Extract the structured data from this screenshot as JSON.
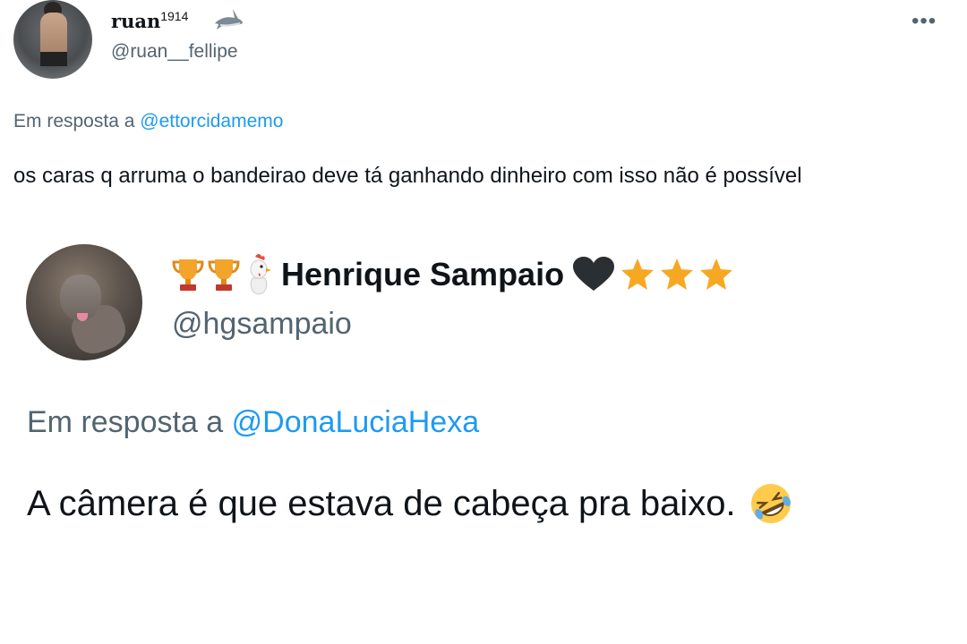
{
  "tweet": {
    "author_name": "ruan",
    "author_name_sup": "1914",
    "author_handle": "@ruan__fellipe",
    "reply_prefix": "Em resposta a",
    "reply_to": "@ettorcidamemo",
    "text": "os caras q arruma o bandeirao deve tá ganhando dinheiro com isso não é possível",
    "more_icon": "more-options-icon"
  },
  "quoted": {
    "author_name": "Henrique Sampaio",
    "author_handle": "@hgsampaio",
    "reply_prefix": "Em resposta a",
    "reply_to": "@DonaLuciaHexa",
    "text": "A câmera é que estava de cabeça pra baixo.",
    "badges_before": [
      "trophy-icon",
      "trophy-icon",
      "rooster-icon"
    ],
    "badges_after": [
      "black-heart-icon",
      "star-icon",
      "star-icon",
      "star-icon"
    ],
    "text_emoji": "rolling-on-floor-laughing-icon"
  },
  "colors": {
    "link": "#1d9bf0",
    "secondary_text": "#536471",
    "primary_text": "#0f1419"
  }
}
